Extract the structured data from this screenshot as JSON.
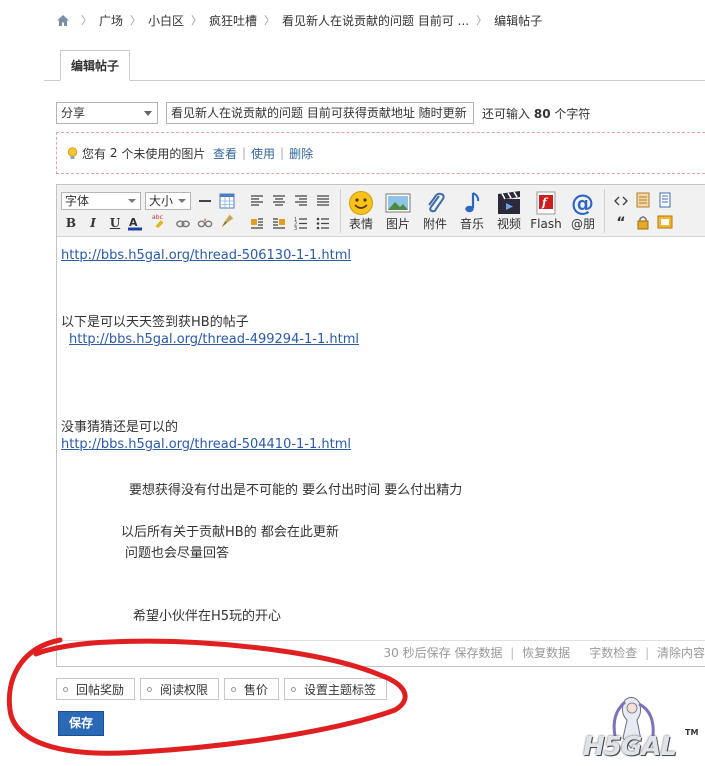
{
  "breadcrumb": {
    "items": [
      "广场",
      "小白区",
      "疯狂吐槽",
      "看见新人在说贡献的问题 目前可 ...",
      "编辑帖子"
    ]
  },
  "tab": {
    "label": "编辑帖子"
  },
  "post_form": {
    "category_value": "分享",
    "title_value": "看见新人在说贡献的问题 目前可获得贡献地址 随时更新",
    "count_prefix": "还可输入",
    "count_value": "80",
    "count_suffix": "个字符"
  },
  "images_notice": {
    "prefix": "您有",
    "count": "2",
    "suffix": "个未使用的图片",
    "view": "查看",
    "use": "使用",
    "delete": "删除"
  },
  "toolbar": {
    "font_family": "字体",
    "font_size": "大小",
    "bold": "B",
    "italic": "I",
    "underline": "U",
    "emoji": "表情",
    "image": "图片",
    "attachment": "附件",
    "music": "音乐",
    "video": "视频",
    "flash": "Flash",
    "mention": "@朋"
  },
  "content": {
    "link1": "http://bbs.h5gal.org/thread-506130-1-1.html",
    "line2": "以下是可以天天签到获HB的帖子",
    "link2": "http://bbs.h5gal.org/thread-499294-1-1.html",
    "line3": "没事猜猜还是可以的",
    "link3": "http://bbs.h5gal.org/thread-504410-1-1.html",
    "line4": "要想获得没有付出是不可能的 要么付出时间 要么付出精力",
    "line5": "以后所有关于贡献HB的 都会在此更新",
    "line6": "问题也会尽量回答",
    "line7": "希望小伙伴在H5玩的开心"
  },
  "status_bar": {
    "autosave": "30 秒后保存",
    "save_data": "保存数据",
    "restore_data": "恢复数据",
    "word_check": "字数检查",
    "clear": "清除内容"
  },
  "options": [
    "回帖奖励",
    "阅读权限",
    "售价",
    "设置主题标签"
  ],
  "save_label": "保存",
  "logo": {
    "text": "H5GAL",
    "tm": "TM"
  },
  "colors": {
    "accent": "#2a69b6",
    "link": "#2a5aa8",
    "annotation": "#e02020"
  }
}
